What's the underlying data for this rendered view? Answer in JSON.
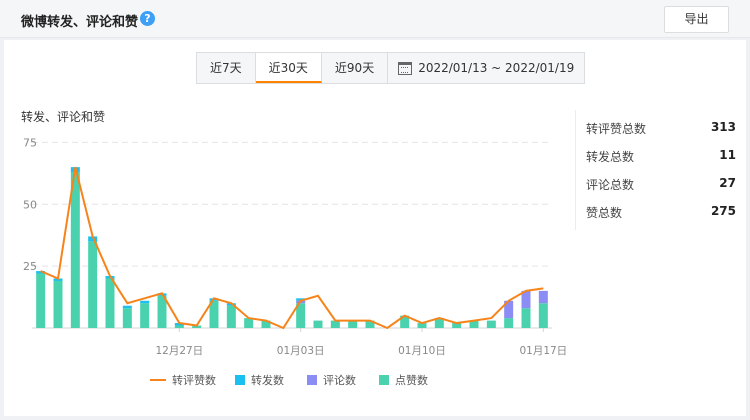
{
  "header": {
    "title": "微博转发、评论和赞",
    "help_glyph": "?",
    "export_label": "导出"
  },
  "tabs": [
    {
      "label": "近7天",
      "active": false
    },
    {
      "label": "近30天",
      "active": true
    },
    {
      "label": "近90天",
      "active": false
    }
  ],
  "date_range": "2022/01/13 ~ 2022/01/19",
  "chart_title": "转发、评论和赞",
  "stats": [
    {
      "label": "转评赞总数",
      "value": "313"
    },
    {
      "label": "转发总数",
      "value": "11"
    },
    {
      "label": "评论总数",
      "value": "27"
    },
    {
      "label": "赞总数",
      "value": "275"
    }
  ],
  "legend": [
    "转评赞数",
    "转发数",
    "评论数",
    "点赞数"
  ],
  "colors": {
    "line": "#f6841a",
    "repost": "#1cc0f0",
    "comment": "#8c8cf5",
    "like": "#4ad2ae",
    "accent": "#ff8200"
  },
  "chart_data": {
    "type": "bar",
    "ylim": [
      0,
      80
    ],
    "yticks": [
      25,
      50,
      75
    ],
    "xticks": [
      {
        "label": "12月27日",
        "index": 8
      },
      {
        "label": "01月03日",
        "index": 15
      },
      {
        "label": "01月10日",
        "index": 22
      },
      {
        "label": "01月17日",
        "index": 29
      }
    ],
    "series": [
      {
        "name": "点赞数",
        "values": [
          22,
          19,
          63,
          35,
          20,
          8,
          10,
          13,
          1,
          1,
          11,
          9,
          4,
          3,
          0,
          10,
          3,
          3,
          3,
          3,
          0,
          5,
          2,
          4,
          2,
          3,
          3,
          4,
          8,
          10
        ]
      },
      {
        "name": "评论数",
        "values": [
          0,
          0,
          0,
          0,
          0,
          0,
          0,
          0,
          0,
          0,
          0,
          0,
          0,
          0,
          0,
          1,
          0,
          0,
          0,
          0,
          0,
          0,
          0,
          0,
          0,
          0,
          0,
          7,
          7,
          5
        ]
      },
      {
        "name": "转发数",
        "values": [
          1,
          1,
          2,
          2,
          1,
          1,
          1,
          1,
          1,
          0,
          1,
          1,
          0,
          0,
          0,
          1,
          0,
          0,
          0,
          0,
          0,
          0,
          0,
          0,
          0,
          0,
          0,
          0,
          0,
          0
        ]
      },
      {
        "name": "转评赞数",
        "values": [
          23,
          20,
          65,
          37,
          21,
          10,
          12,
          14,
          2,
          1,
          12,
          10,
          4,
          3,
          0,
          11,
          13,
          3,
          3,
          3,
          0,
          5,
          2,
          4,
          2,
          3,
          4,
          11,
          15,
          16
        ]
      }
    ]
  }
}
